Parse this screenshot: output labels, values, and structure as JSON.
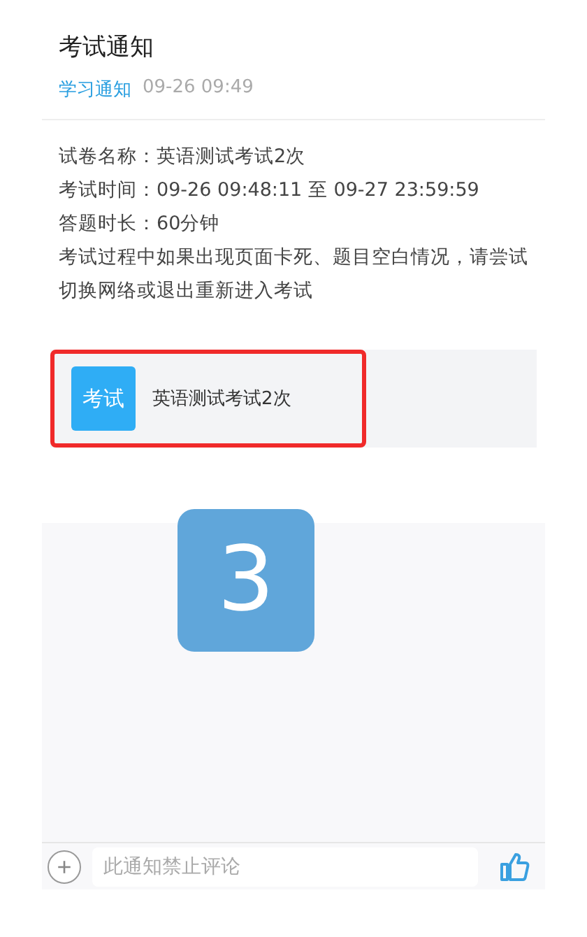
{
  "notice": {
    "title": "考试通知",
    "category": "学习通知",
    "time": "09-26 09:49"
  },
  "details": [
    "试卷名称：英语测试考试2次",
    "考试时间：09-26 09:48:11 至 09-27 23:59:59",
    "答题时长：60分钟",
    "考试过程中如果出现页面卡死、题目空白情况，请尝试切换网络或退出重新进入考试"
  ],
  "attachment": {
    "badge": "考试",
    "name": "英语测试考试2次",
    "highlighted": true
  },
  "step_marker": "3",
  "comment_bar": {
    "plus": "+",
    "placeholder": "此通知禁止评论"
  }
}
